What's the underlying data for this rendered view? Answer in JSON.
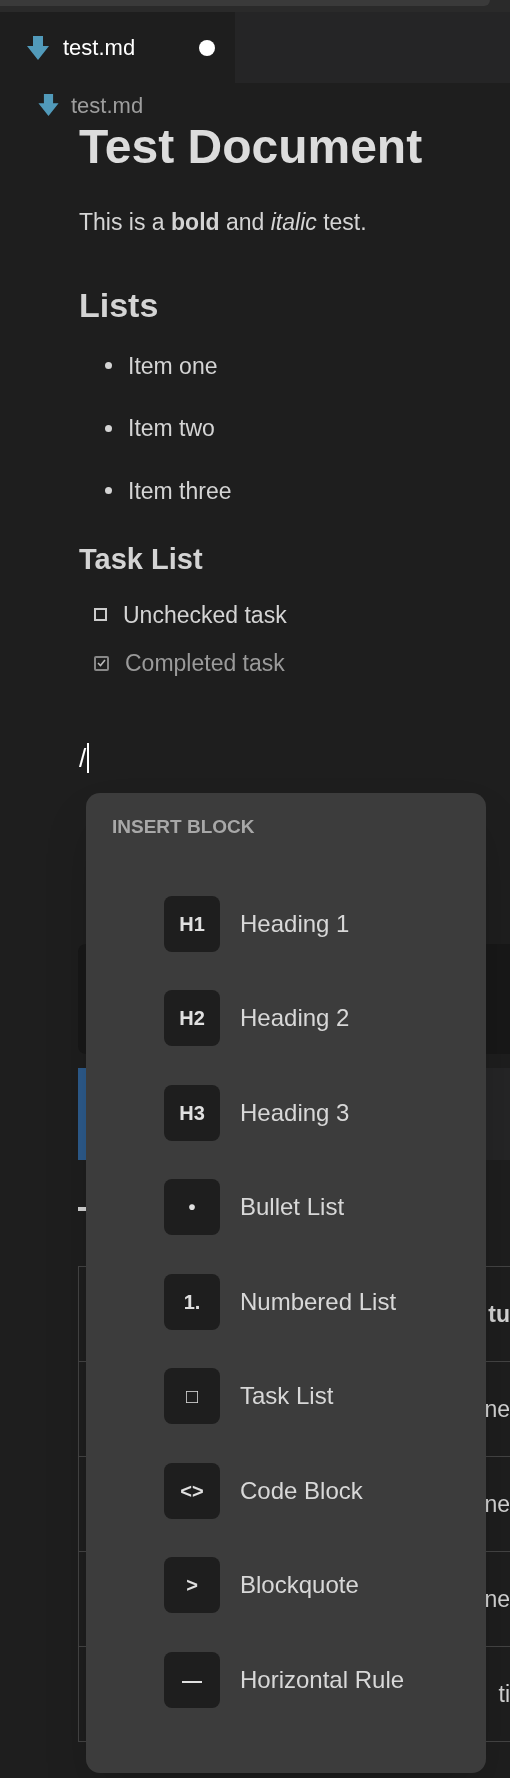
{
  "tab": {
    "label": "test.md",
    "modified": true
  },
  "breadcrumb": "test.md",
  "document": {
    "title": "Test Document",
    "paragraph": "This is a **bold** and *italic* test.",
    "lists_heading": "Lists",
    "bullets": [
      "Item one",
      "Item two",
      "Item three"
    ],
    "tasks_heading": "Task List",
    "tasks": [
      {
        "label": "Unchecked task",
        "checked": false
      },
      {
        "label": "Completed task",
        "checked": true
      }
    ],
    "typed": "/",
    "table_cells": [
      {
        "text": "tu",
        "header": true
      },
      {
        "text": "ne",
        "header": false
      },
      {
        "text": "ne",
        "header": false
      },
      {
        "text": "ne",
        "header": false
      },
      {
        "text": "ti",
        "header": false
      }
    ]
  },
  "menu": {
    "title": "INSERT BLOCK",
    "items": [
      {
        "icon": "H1",
        "label": "Heading 1"
      },
      {
        "icon": "H2",
        "label": "Heading 2"
      },
      {
        "icon": "H3",
        "label": "Heading 3"
      },
      {
        "icon": "•",
        "label": "Bullet List"
      },
      {
        "icon": "1.",
        "label": "Numbered List"
      },
      {
        "icon": "□",
        "label": "Task List"
      },
      {
        "icon": "<>",
        "label": "Code Block"
      },
      {
        "icon": ">",
        "label": "Blockquote"
      },
      {
        "icon": "—",
        "label": "Horizontal Rule"
      }
    ]
  }
}
